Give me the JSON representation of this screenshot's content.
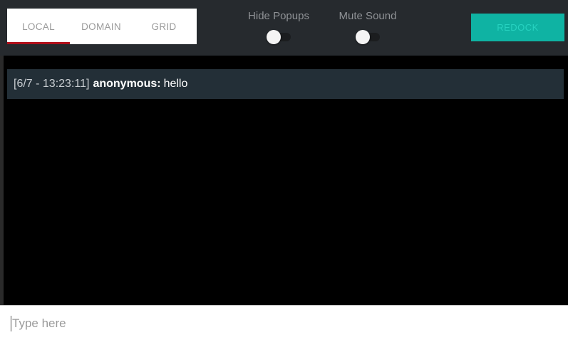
{
  "header": {
    "tabs": [
      {
        "label": "LOCAL",
        "active": true
      },
      {
        "label": "DOMAIN",
        "active": false
      },
      {
        "label": "GRID",
        "active": false
      }
    ],
    "hide_popups": {
      "label": "Hide Popups",
      "on": false
    },
    "mute_sound": {
      "label": "Mute Sound",
      "on": false
    },
    "redock_label": "REDOCK"
  },
  "messages": [
    {
      "timestamp": "[6/7 - 13:23:11]",
      "user": "anonymous:",
      "text": "hello"
    }
  ],
  "input": {
    "value": "",
    "placeholder": "Type here"
  },
  "colors": {
    "header_bg": "#262a2e",
    "chat_bg": "#000000",
    "message_bg": "#232f37",
    "active_tab_underline": "#b10f1a",
    "redock_bg": "#0fb3a3"
  }
}
